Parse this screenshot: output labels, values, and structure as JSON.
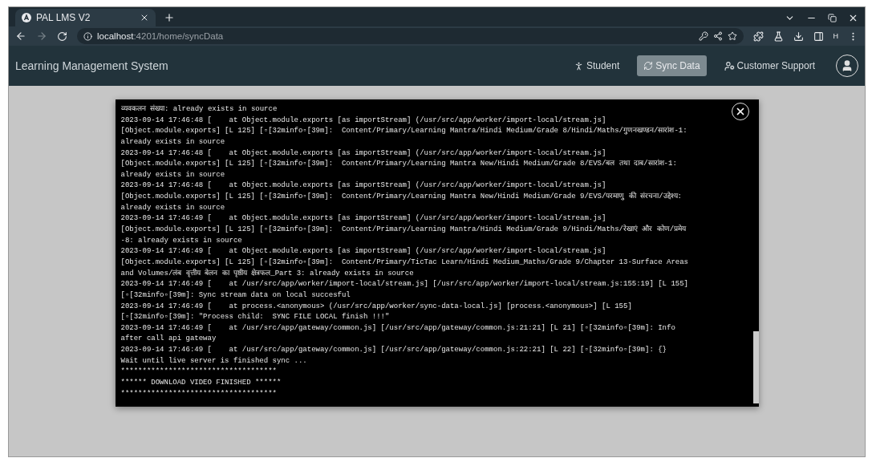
{
  "browser": {
    "tab_title": "PAL LMS V2",
    "url_host": "localhost",
    "url_path": ":4201/home/syncData",
    "profile_initial": "H"
  },
  "app": {
    "title": "Learning Management System",
    "nav": [
      {
        "label": "Student",
        "selected": false
      },
      {
        "label": "Sync Data",
        "selected": true
      },
      {
        "label": "Customer Support",
        "selected": false
      }
    ]
  },
  "log_dialog": {
    "lines": [
      "व्यवकलन संख्या: already exists in source",
      "2023-09-14 17:46:48 [    at Object.module.exports [as importStream] (/usr/src/app/worker/import-local/stream.js]",
      "[Object.module.exports] [L 125] [▫[32minfo▫[39m]:  Content/Primary/Learning Mantra/Hindi Medium/Grade 8/Hindi/Maths/गुणनखण्डन/सारांश-1:",
      "already exists in source",
      "2023-09-14 17:46:48 [    at Object.module.exports [as importStream] (/usr/src/app/worker/import-local/stream.js]",
      "[Object.module.exports] [L 125] [▫[32minfo▫[39m]:  Content/Primary/Learning Mantra New/Hindi Medium/Grade 8/EVS/बल तथा दाब/सारांश-1:",
      "already exists in source",
      "2023-09-14 17:46:48 [    at Object.module.exports [as importStream] (/usr/src/app/worker/import-local/stream.js]",
      "[Object.module.exports] [L 125] [▫[32minfo▫[39m]:  Content/Primary/Learning Mantra New/Hindi Medium/Grade 9/EVS/परमाणु की संरचना/उद्देश्य:",
      "already exists in source",
      "2023-09-14 17:46:49 [    at Object.module.exports [as importStream] (/usr/src/app/worker/import-local/stream.js]",
      "[Object.module.exports] [L 125] [▫[32minfo▫[39m]:  Content/Primary/Learning Mantra/Hindi Medium/Grade 9/Hindi/Maths/रेखाएं और कोण/प्रमेय",
      "-8: already exists in source",
      "2023-09-14 17:46:49 [    at Object.module.exports [as importStream] (/usr/src/app/worker/import-local/stream.js]",
      "[Object.module.exports] [L 125] [▫[32minfo▫[39m]:  Content/Primary/TicTac Learn/Hindi Medium_Maths/Grade 9/Chapter 13-Surface Areas",
      "and Volumes/लंब वृत्तीय बेलन का पृष्ठीय क्षेत्रफल_Part 3: already exists in source",
      "2023-09-14 17:46:49 [    at /usr/src/app/worker/import-local/stream.js] [/usr/src/app/worker/import-local/stream.js:155:19] [L 155]",
      "[▫[32minfo▫[39m]: Sync stream data on local succesful",
      "2023-09-14 17:46:49 [    at process.<anonymous> (/usr/src/app/worker/sync-data-local.js] [process.<anonymous>] [L 155]",
      "[▫[32minfo▫[39m]: \"Process child:  SYNC FILE LOCAL finish !!!\"",
      "2023-09-14 17:46:49 [    at /usr/src/app/gateway/common.js] [/usr/src/app/gateway/common.js:21:21] [L 21] [▫[32minfo▫[39m]: Info",
      "after call api gateway",
      "2023-09-14 17:46:49 [    at /usr/src/app/gateway/common.js] [/usr/src/app/gateway/common.js:22:21] [L 22] [▫[32minfo▫[39m]: {}",
      "Wait until live server is finished sync ...",
      "************************************",
      "****** DOWNLOAD VIDEO FINISHED ******",
      "************************************"
    ]
  }
}
